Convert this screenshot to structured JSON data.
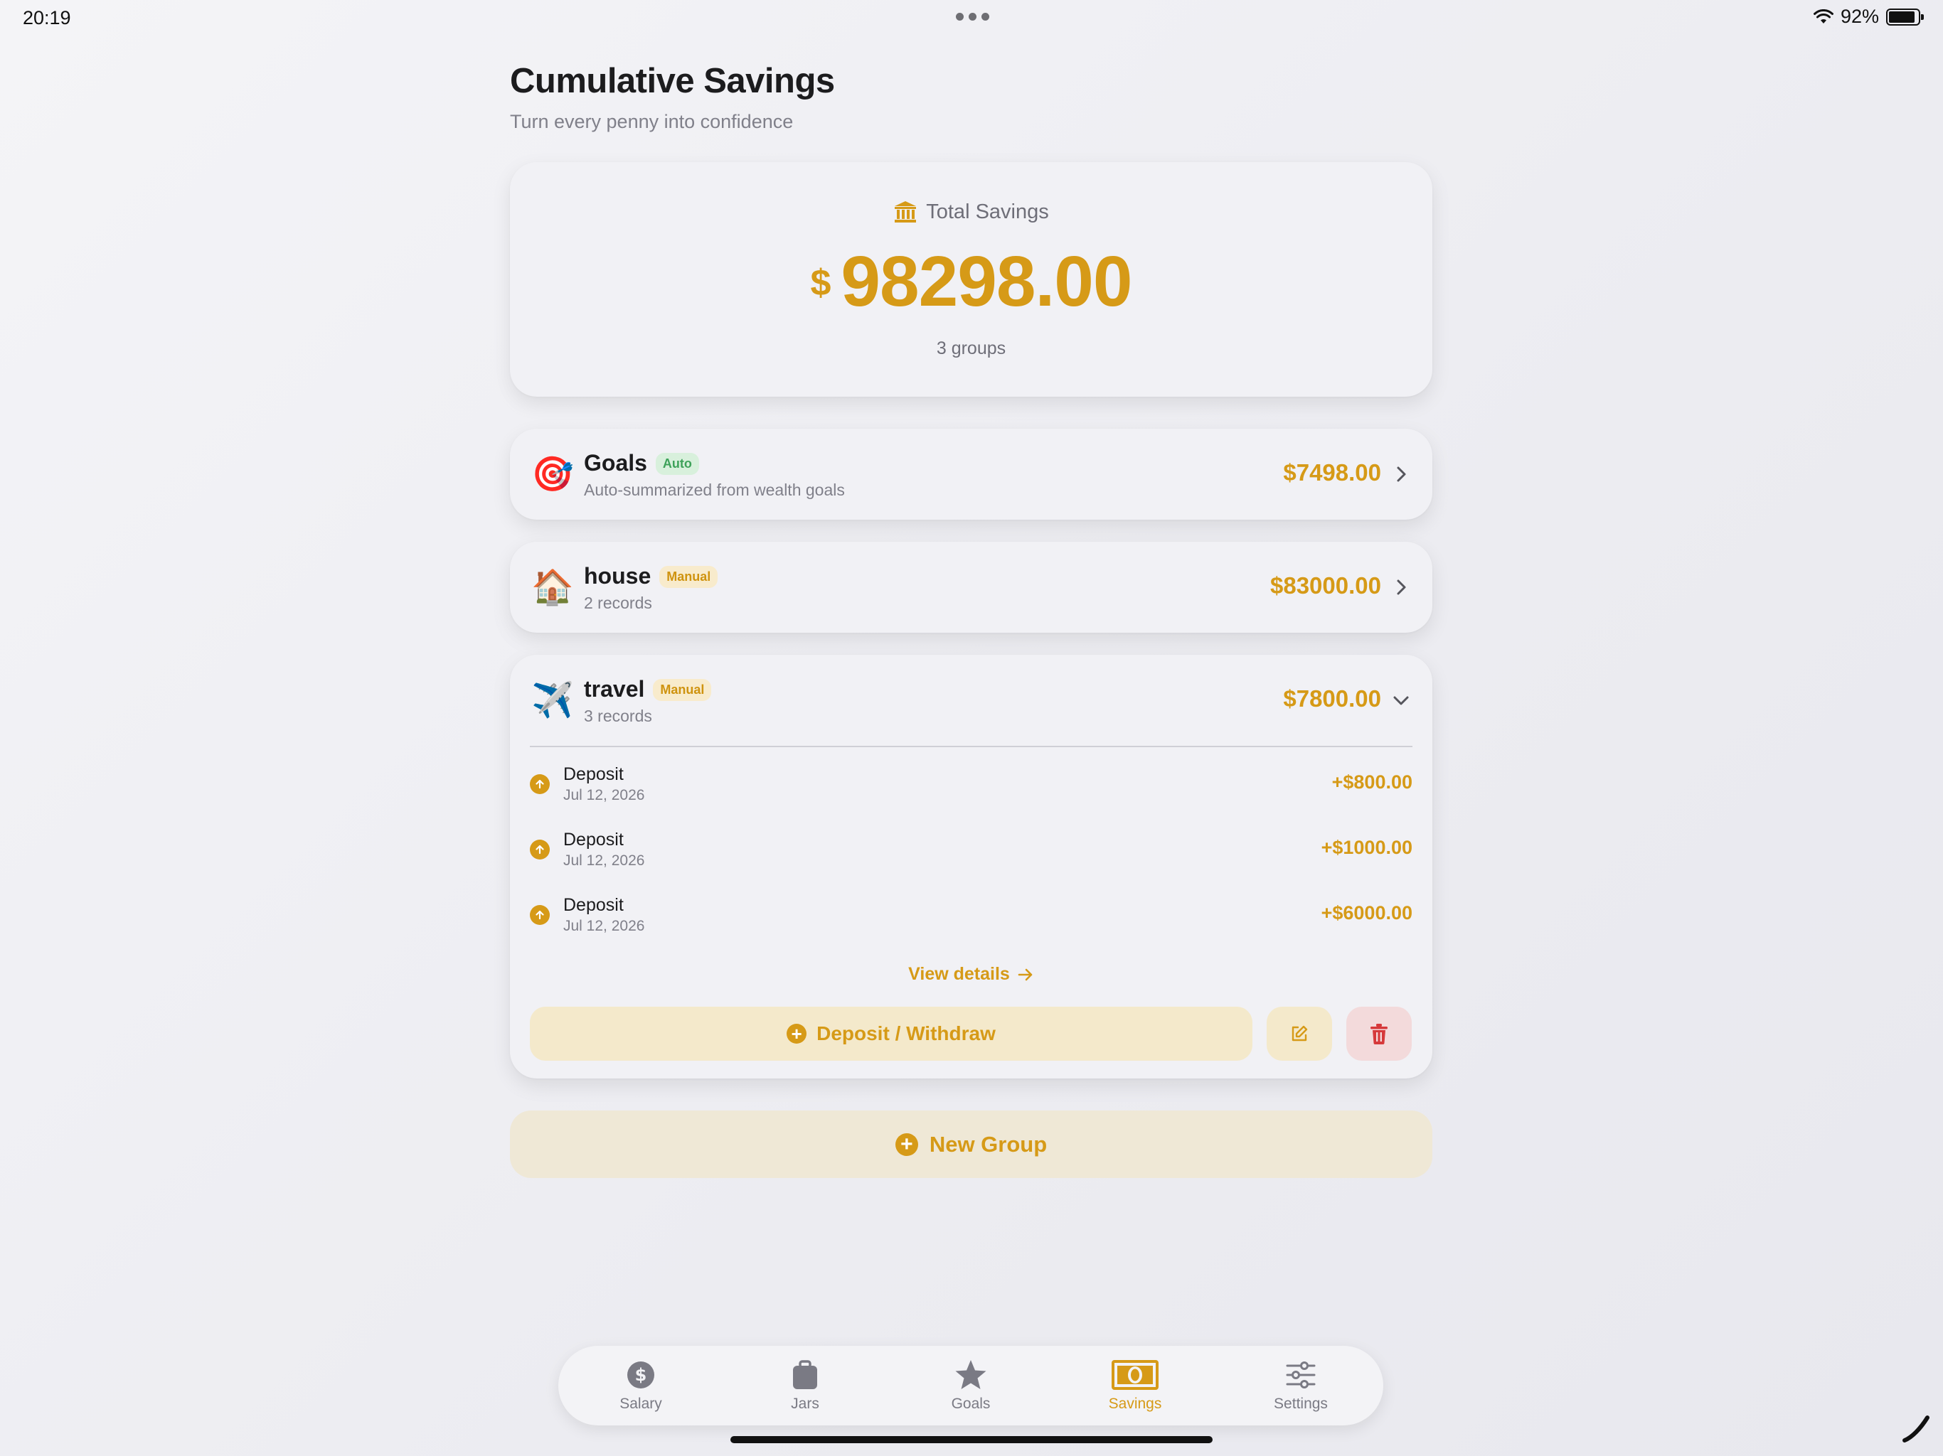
{
  "status_bar": {
    "time": "20:19",
    "battery": "92%"
  },
  "header": {
    "title": "Cumulative Savings",
    "subtitle": "Turn every penny into confidence"
  },
  "total": {
    "label": "Total Savings",
    "currency": "$",
    "amount": "98298.00",
    "groups_count": "3 groups",
    "icon": "bank-icon"
  },
  "groups": [
    {
      "emoji": "🎯",
      "name": "Goals",
      "badge": "Auto",
      "subtitle": "Auto-summarized from wealth goals",
      "amount": "$7498.00",
      "expanded": false
    },
    {
      "emoji": "🏠",
      "name": "house",
      "badge": "Manual",
      "subtitle": "2 records",
      "amount": "$83000.00",
      "expanded": false
    },
    {
      "emoji": "✈️",
      "name": "travel",
      "badge": "Manual",
      "subtitle": "3 records",
      "amount": "$7800.00",
      "expanded": true,
      "records": [
        {
          "title": "Deposit",
          "date": "Jul 12, 2026",
          "amount": "+$800.00"
        },
        {
          "title": "Deposit",
          "date": "Jul 12, 2026",
          "amount": "+$1000.00"
        },
        {
          "title": "Deposit",
          "date": "Jul 12, 2026",
          "amount": "+$6000.00"
        }
      ],
      "view_details": "View details",
      "deposit_withdraw": "Deposit / Withdraw"
    }
  ],
  "new_group": "New Group",
  "tabs": [
    {
      "label": "Salary",
      "icon": "dollar-circle-icon",
      "active": false
    },
    {
      "label": "Jars",
      "icon": "bag-icon",
      "active": false
    },
    {
      "label": "Goals",
      "icon": "star-icon",
      "active": false
    },
    {
      "label": "Savings",
      "icon": "banknote-icon",
      "active": true
    },
    {
      "label": "Settings",
      "icon": "sliders-icon",
      "active": false
    }
  ],
  "colors": {
    "accent": "#d69a17",
    "auto_badge": "#3ea25a",
    "delete": "#d6393b"
  }
}
